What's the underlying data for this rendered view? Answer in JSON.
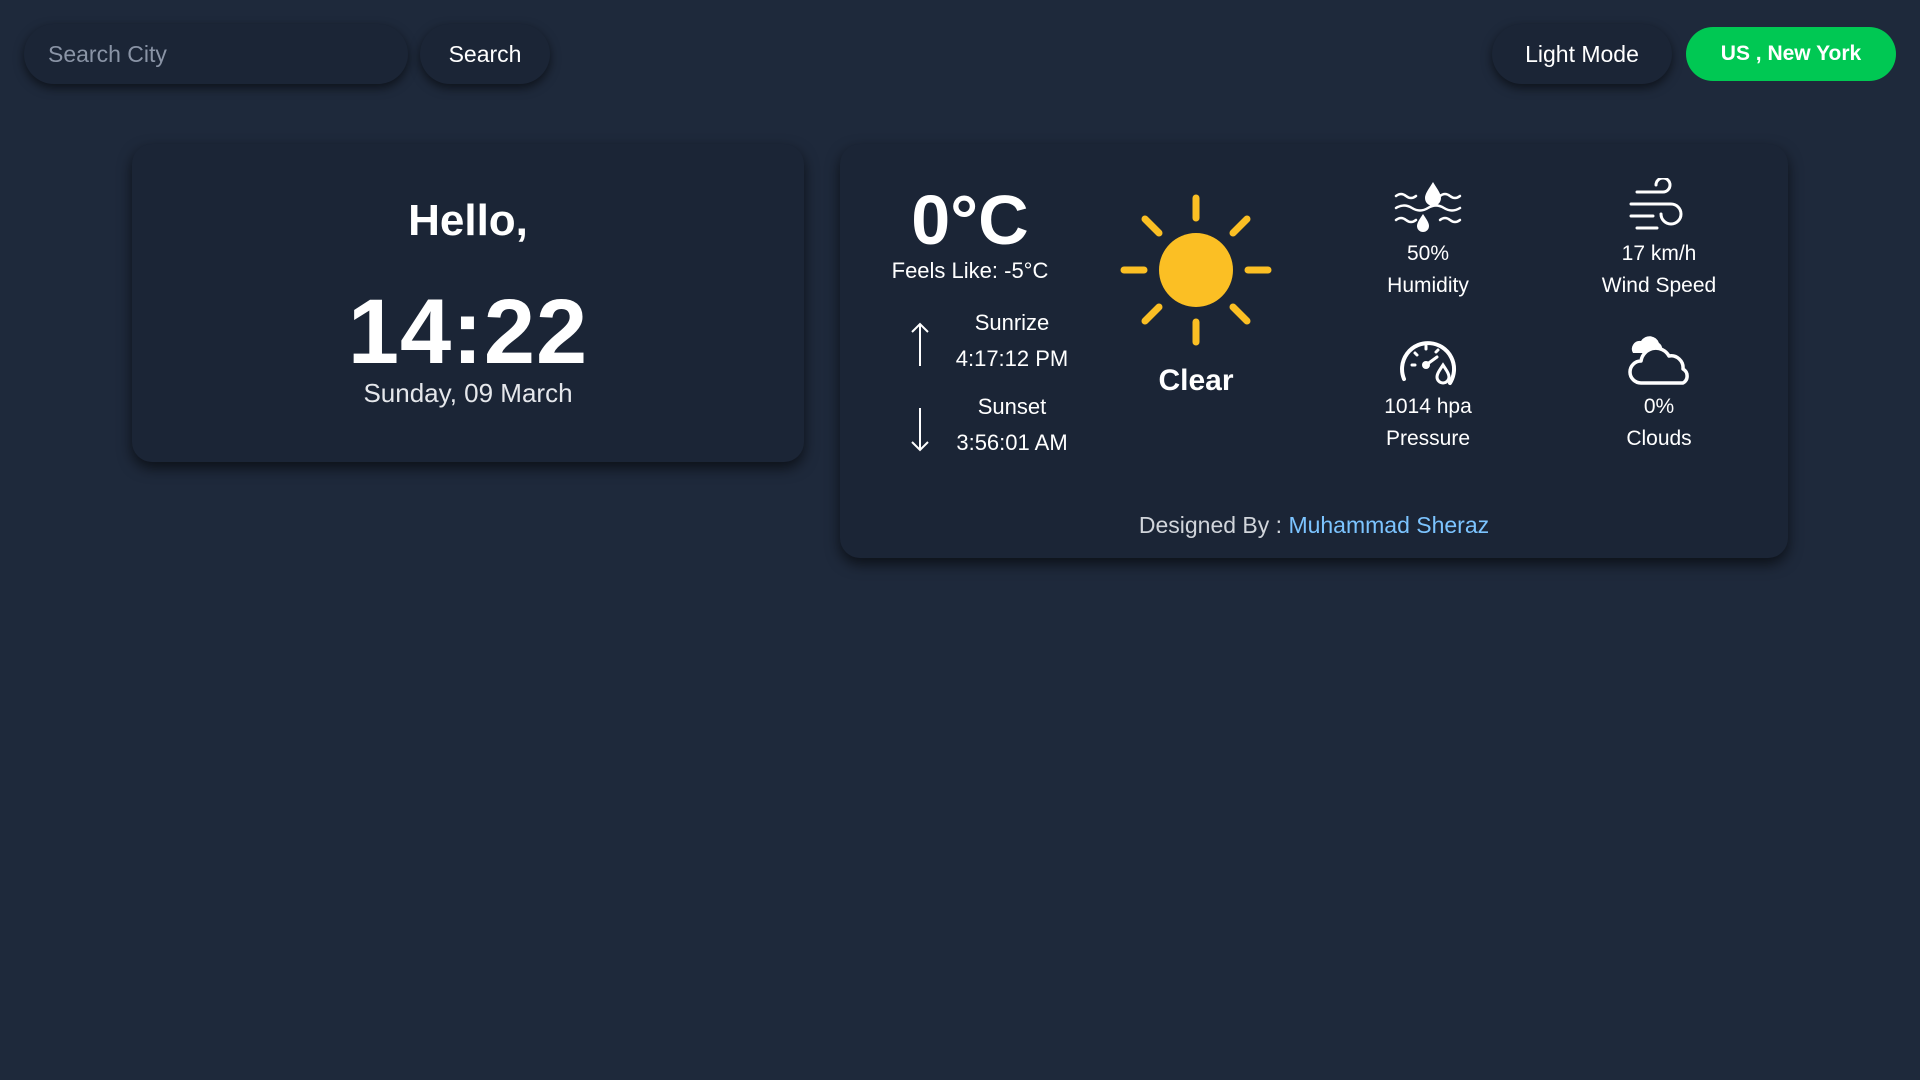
{
  "search": {
    "placeholder": "Search City",
    "button_label": "Search"
  },
  "header": {
    "mode_button_label": "Light Mode",
    "location_label": "US , New York",
    "location_color": "#00c853"
  },
  "clock_card": {
    "greeting": "Hello,",
    "time": "14:22",
    "date": "Sunday, 09 March"
  },
  "weather_card": {
    "temperature": "0°C",
    "feels_like": "Feels Like: -5°C",
    "sunrise": {
      "label": "Sunrize",
      "time": "4:17:12 PM",
      "icon": "arrow-up-icon"
    },
    "sunset": {
      "label": "Sunset",
      "time": "3:56:01 AM",
      "icon": "arrow-down-icon"
    },
    "condition": {
      "label": "Clear",
      "icon": "sun-icon",
      "color": "#fbbf24"
    },
    "stats": {
      "humidity": {
        "value": "50%",
        "label": "Humidity",
        "icon": "humidity-icon"
      },
      "wind": {
        "value": "17 km/h",
        "label": "Wind Speed",
        "icon": "wind-icon"
      },
      "pressure": {
        "value": "1014 hpa",
        "label": "Pressure",
        "icon": "pressure-gauge-icon"
      },
      "clouds": {
        "value": "0%",
        "label": "Clouds",
        "icon": "cloud-icon"
      }
    },
    "footer": {
      "prefix": "Designed By : ",
      "author": "Muhammad Sheraz",
      "author_color": "#7cc4ff"
    }
  },
  "colors": {
    "background": "#1e293b",
    "card": "#1b2536"
  }
}
